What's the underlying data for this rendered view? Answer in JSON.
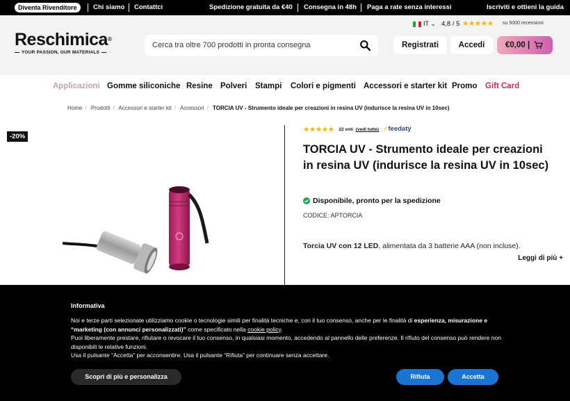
{
  "topbar": {
    "reseller": "Diventa Rivenditore",
    "about": "Chi siamo",
    "contacts": "Contattci",
    "shipping": "Spedizione gratuita da €40",
    "delivery": "Consegna in 48h",
    "installments": "Paga a rate senza interessi",
    "signup": "Iscriviti e ottieni la guida"
  },
  "header": {
    "logo_name": "Reschimica",
    "logo_tag": "YOUR PASSION, OUR MATERIALS",
    "search_placeholder": "Cerca tra oltre 700 prodotti in pronta consegna",
    "language": "IT",
    "rating": "4,8 / 5",
    "reviews": "su 5000 recensioni",
    "register": "Registrati",
    "login": "Accedi",
    "cart_total": "€0,00 |"
  },
  "nav": {
    "items": [
      "Applicazioni",
      "Gomme siliconiche",
      "Resine",
      "Polveri",
      "Stampi",
      "Colori e pigmenti",
      "Accessori e starter kit",
      "Promo",
      "Gift Card"
    ]
  },
  "breadcrumbs": [
    "Home",
    "Prodotti",
    "Accessori e starter kit",
    "Accessori",
    "TORCIA UV - Strumento ideale per creazioni in resina UV (indurisce la resina UV in 10sec)"
  ],
  "product": {
    "discount": "-20%",
    "votes": "22 voti",
    "see_all": "(vedi tutte)",
    "feedaty": "feedaty",
    "title": "TORCIA UV - Strumento ideale per creazioni in resina UV (indurisce la resina UV in 10sec)",
    "availability": "Disponibile, pronto per la spedizione",
    "code": "CODICE: APTORCIA",
    "desc_bold": "Torcia UV con 12 LED",
    "desc_rest": ", alimentata da 3 batterie AAA (non incluse).",
    "read_more": "Leggi di più +"
  },
  "cookie": {
    "title": "Informativa",
    "p1a": "Noi e terze parti selezionate utilizziamo cookie o tecnologie simili per finalità tecniche e, con il tuo consenso, anche per le finalità di ",
    "p1b": "esperienza, misurazione e “marketing (con annunci personalizzati)”",
    "p1c": " come specificato nella ",
    "p1link": "cookie policy",
    "p1d": ".",
    "p2": "Puoi liberamente prestare, rifiutare o revocare il tuo consenso, in qualsiasi momento, accedendo al pannello delle preferenze. Il rifiuto del consenso può rendere non disponibili le relative funzioni.",
    "p3": "Usa il pulsante “Accetta” per acconsentire. Usa il pulsante “Rifiuta” per continuare senza accettare.",
    "more_btn": "Scopri di più e personalizza",
    "reject_btn": "Rifiuta",
    "accept_btn": "Accetta"
  },
  "colors": {
    "accent_pink": "#e0356c",
    "nav_first": "#c9a0b5",
    "cookie_blue": "#1a74d2",
    "star": "#f5b400",
    "available_green": "#1aa64a"
  }
}
